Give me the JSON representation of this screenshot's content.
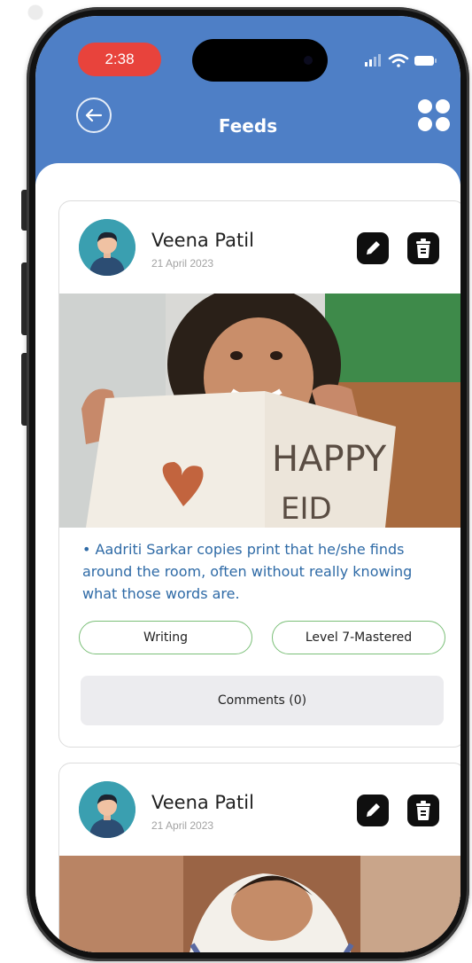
{
  "status_bar": {
    "time": "2:38"
  },
  "header": {
    "title": "Feeds"
  },
  "colors": {
    "header": "#4e7fc6",
    "text_blue": "#2e6aa6",
    "chip_border": "#7bbf78",
    "time_pill": "#e8433c"
  },
  "feeds": [
    {
      "author": "Veena Patil",
      "date": "21 April 2023",
      "photo_text": {
        "line1": "HAPPY",
        "line2": "EID"
      },
      "description": "• Aadriti  Sarkar copies print that he/she finds around the room, often without really knowing what those words are.",
      "tags": [
        "Writing",
        "Level 7-Mastered"
      ],
      "comments_label": "Comments (0)"
    },
    {
      "author": "Veena Patil",
      "date": "21 April 2023"
    }
  ],
  "icons": {
    "back": "back-arrow-icon",
    "grid": "grid-menu-icon",
    "edit": "edit-pencil-icon",
    "delete": "trash-icon"
  }
}
